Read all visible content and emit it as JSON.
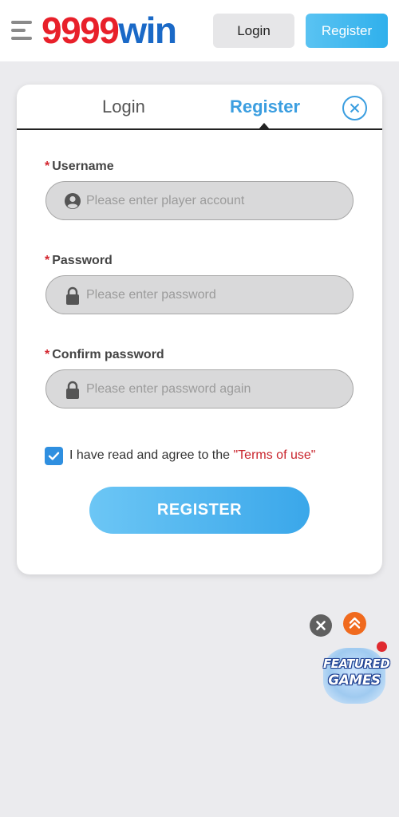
{
  "header": {
    "logo_number": "9999",
    "logo_word": "win",
    "login_label": "Login",
    "register_label": "Register"
  },
  "modal": {
    "tabs": [
      {
        "label": "Login",
        "active": false
      },
      {
        "label": "Register",
        "active": true
      }
    ],
    "fields": [
      {
        "required_mark": "*",
        "label": "Username",
        "placeholder": "Please enter player account",
        "value": "",
        "icon": "user-circle-icon"
      },
      {
        "required_mark": "*",
        "label": "Password",
        "placeholder": "Please enter password",
        "value": "",
        "icon": "lock-icon"
      },
      {
        "required_mark": "*",
        "label": "Confirm password",
        "placeholder": "Please enter password again",
        "value": "",
        "icon": "lock-icon"
      }
    ],
    "agree": {
      "checked": true,
      "text": "I have read and agree to the ",
      "link_text": "\"Terms of use\""
    },
    "submit_label": "REGISTER"
  },
  "floating": {
    "featured_line1": "FEATURED",
    "featured_line2": "GAMES"
  },
  "colors": {
    "accent_blue": "#3b9ee0",
    "logo_red": "#e8202a",
    "logo_blue": "#1a69c7",
    "required_red": "#d3262f",
    "terms_red": "#c9252d",
    "scroll_top_orange": "#f06a1e"
  }
}
